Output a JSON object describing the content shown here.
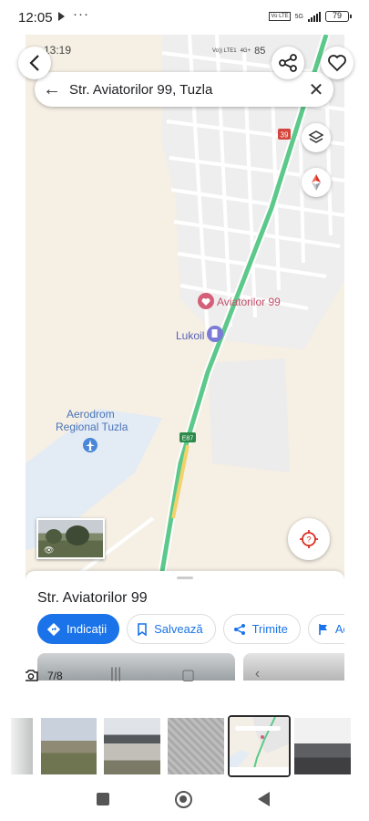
{
  "status_bar": {
    "time": "12:05",
    "dots": "···",
    "volte": "Vo LTE",
    "network": "5G",
    "battery": "79"
  },
  "viewer": {
    "back_icon": "chevron-left-icon",
    "share_icon": "share-icon",
    "favorite_icon": "heart-outline-icon",
    "counter": "7/8"
  },
  "embedded_app": {
    "status_time": "13:19",
    "status_volte": "Vo)) LTE1",
    "status_network": "4G+",
    "status_battery": "85",
    "search": {
      "query": "Str. Aviatorilor 99, Tuzla",
      "back_icon": "arrow-left-icon",
      "clear_icon": "close-icon"
    },
    "map": {
      "road_badge_1": "39",
      "road_badge_2": "E87",
      "pin_label": "Aviatorilor 99",
      "poi_fuel": "Lukoil",
      "poi_airport_line1": "Aerodrom",
      "poi_airport_line2": "Regional Tuzla",
      "layers_icon": "layers-icon",
      "compass_icon": "compass-icon",
      "locate_icon": "my-location-icon",
      "colors": {
        "land": "#f5efe4",
        "roads": "#ffffff",
        "highway": "#5cc98a",
        "airport": "#e3ebf5",
        "pin": "#d45f78"
      }
    },
    "place": {
      "title": "Str. Aviatorilor 99",
      "actions": [
        {
          "label": "Indicații",
          "icon": "directions-icon"
        },
        {
          "label": "Salvează",
          "icon": "bookmark-icon"
        },
        {
          "label": "Trimite",
          "icon": "share-icon"
        },
        {
          "label": "Ac",
          "icon": "flag-icon"
        }
      ]
    }
  },
  "gallery": {
    "thumbnails": [
      "room",
      "house-yard",
      "house-construction",
      "floor-plan",
      "map-screenshot",
      "interior"
    ],
    "selected_index": 4
  },
  "system_nav": {
    "recent": "recents-icon",
    "home": "home-icon",
    "back": "back-icon"
  }
}
